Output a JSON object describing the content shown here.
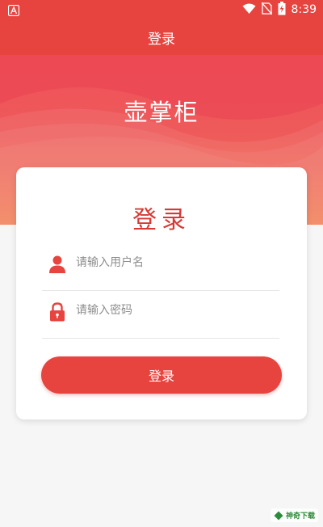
{
  "status_bar": {
    "time": "8:39"
  },
  "app_bar": {
    "title": "登录"
  },
  "hero": {
    "app_name": "壶掌柜"
  },
  "login_card": {
    "heading": "登录",
    "username_placeholder": "请输入用户名",
    "password_placeholder": "请输入密码",
    "login_button_label": "登录"
  },
  "watermark": {
    "text": "神奇下载"
  },
  "colors": {
    "primary": "#e8443f",
    "heading": "#d63a35"
  }
}
